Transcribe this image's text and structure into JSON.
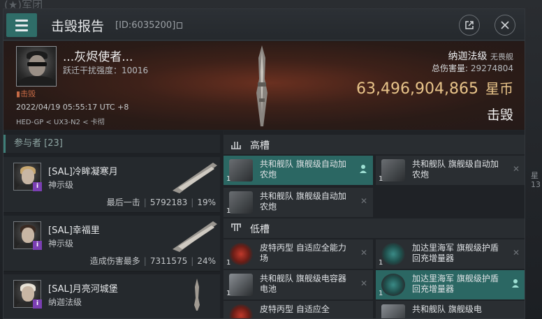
{
  "background": {
    "corner_text": "(★)军团",
    "right_text": "星\n13"
  },
  "header": {
    "title": "击毁报告",
    "kill_id": "[ID:6035200]"
  },
  "victim": {
    "name": "...灰烬使者...",
    "jam_strength": "跃迁干扰强度：10016",
    "status_tag": "击毁",
    "datetime": "2022/04/19 05:55:17 UTC +8",
    "location": "HED-GP < UX3-N2 < 卡彻",
    "ship_class": "纳迦法级",
    "ship_class_sub": "无畏舰",
    "total_damage_label": "总伤害量:",
    "total_damage": "29274804",
    "isk_value": "63,496,904,865",
    "isk_currency": "星币",
    "result": "击毁"
  },
  "participants": {
    "heading": "参与者 [23]",
    "items": [
      {
        "name": "[SAL]冷眸凝寒月",
        "ship": "神示级",
        "label": "最后一击",
        "damage": "5792183",
        "percent": "19%"
      },
      {
        "name": "[SAL]幸福里",
        "ship": "神示级",
        "label": "造成伤害最多",
        "damage": "7311575",
        "percent": "24%"
      },
      {
        "name": "[SAL]月亮河城堡",
        "ship": "纳迦法级",
        "label": "",
        "damage": "",
        "percent": ""
      }
    ]
  },
  "fitting": {
    "high_slot_label": "高槽",
    "low_slot_label": "低槽",
    "high": [
      {
        "name": "共和舰队 旗舰级自动加农炮",
        "qty": "1",
        "highlight": true
      },
      {
        "name": "共和舰队 旗舰级自动加农炮",
        "qty": "1",
        "highlight": false
      },
      {
        "name": "共和舰队 旗舰级自动加农炮",
        "qty": "1",
        "highlight": false
      }
    ],
    "low": [
      {
        "name": "皮特丙型 自适应全能力场",
        "qty": "1",
        "highlight": false
      },
      {
        "name": "加达里海军 旗舰级护盾回充增量器",
        "qty": "1",
        "highlight": false
      },
      {
        "name": "共和舰队 旗舰级电容器电池",
        "qty": "1",
        "highlight": false
      },
      {
        "name": "加达里海军 旗舰级护盾回充增量器",
        "qty": "1",
        "highlight": true
      },
      {
        "name": "皮特丙型 自适应全",
        "qty": "",
        "highlight": false
      },
      {
        "name": "共和舰队 旗舰级电",
        "qty": "",
        "highlight": false
      }
    ]
  },
  "colors": {
    "accent": "#2f6d68",
    "isk": "#e8c48a",
    "kill_tag": "#c66a45"
  }
}
